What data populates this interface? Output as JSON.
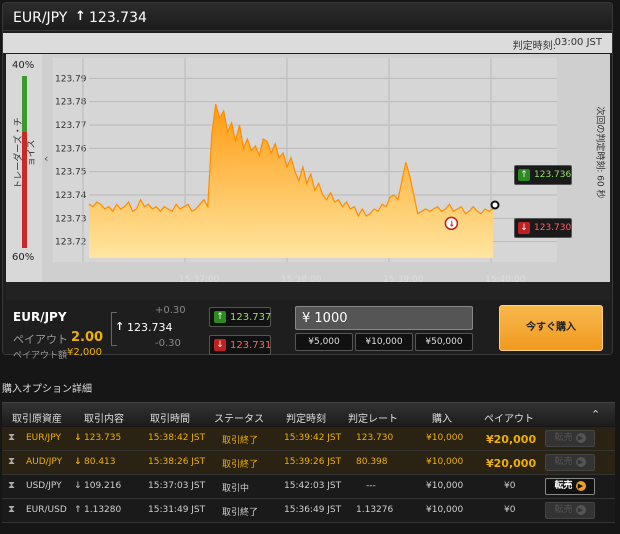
{
  "header": {
    "pair": "EUR/JPY",
    "arrow": "↑",
    "price": "123.734"
  },
  "judge": {
    "label": "判定時刻:",
    "time": "03:00 JST"
  },
  "trader_choice": {
    "top_pct": "40%",
    "bottom_pct": "60%",
    "label": "トレーダーズ・チョイス",
    "collapse": "‹"
  },
  "next_judge": {
    "label": "次回の判定時刻: 60 秒"
  },
  "chart_data": {
    "type": "area",
    "x_ticks": [
      "15:37:00",
      "15:38:00",
      "15:39:00",
      "15:40:00"
    ],
    "y_ticks": [
      "123.79",
      "123.78",
      "123.77",
      "123.76",
      "123.75",
      "123.74",
      "123.73",
      "123.72"
    ],
    "ylim": [
      123.713,
      123.797
    ],
    "x": [
      0,
      2,
      4,
      6,
      8,
      10,
      12,
      14,
      16,
      18,
      20,
      22,
      24,
      26,
      28,
      30,
      32,
      34,
      36,
      38,
      40,
      42,
      44,
      46,
      48,
      50,
      52,
      54,
      56,
      58,
      60,
      62,
      64,
      66,
      68,
      70,
      72,
      74,
      76,
      78,
      80,
      82,
      84,
      86,
      88,
      90,
      92,
      94,
      96,
      98,
      100,
      102,
      104,
      106,
      108,
      110,
      112,
      114,
      116,
      118,
      120,
      122,
      124,
      126,
      128,
      130,
      132,
      134,
      136,
      138,
      140,
      142,
      144,
      146,
      148,
      150,
      152,
      154,
      156,
      158,
      160,
      162,
      164,
      166,
      168,
      170,
      172,
      174,
      176,
      178,
      180,
      182,
      184,
      186,
      188,
      190,
      192,
      194,
      196,
      198,
      200,
      202,
      204
    ],
    "values": [
      123.736,
      123.735,
      123.737,
      123.736,
      123.734,
      123.735,
      123.733,
      123.736,
      123.734,
      123.735,
      123.737,
      123.733,
      123.734,
      123.738,
      123.735,
      123.736,
      123.734,
      123.735,
      123.733,
      123.735,
      123.734,
      123.733,
      123.736,
      123.734,
      123.735,
      123.736,
      123.733,
      123.734,
      123.736,
      123.738,
      123.735,
      123.766,
      123.779,
      123.773,
      123.776,
      123.767,
      123.771,
      123.763,
      123.77,
      123.76,
      123.764,
      123.759,
      123.761,
      123.757,
      123.764,
      123.763,
      123.758,
      123.762,
      123.756,
      123.758,
      123.752,
      123.756,
      123.75,
      123.746,
      123.752,
      123.745,
      123.749,
      123.742,
      123.745,
      123.74,
      123.738,
      123.741,
      123.737,
      123.738,
      123.735,
      123.737,
      123.734,
      123.735,
      123.731,
      123.734,
      123.731,
      123.732,
      123.734,
      123.733,
      123.736,
      123.735,
      123.739,
      123.74,
      123.738,
      123.746,
      123.754,
      123.748,
      123.74,
      123.732,
      123.733,
      123.734,
      123.733,
      123.734,
      123.735,
      123.733,
      123.734,
      123.736,
      123.733,
      123.734,
      123.735,
      123.732,
      123.733,
      123.735,
      123.733,
      123.732,
      123.734,
      123.733,
      123.734
    ],
    "upper_tag": "123.736",
    "lower_tag": "123.730",
    "grid": true,
    "colors": {
      "fill_top": "#ff9a10",
      "fill_bottom": "#ffe6a0",
      "line": "#ff8c00",
      "bg": "#d6d6d6"
    }
  },
  "order": {
    "pair": "EUR/JPY",
    "payout_label": "ペイアウト",
    "payout": "2.00",
    "amount_label": "ペイアウト額",
    "amount": "¥2,000",
    "arrow": "↑",
    "price": "123.734",
    "plus": "+0.30",
    "minus": "-0.30",
    "high_price": "123.737",
    "low_price": "123.731",
    "input_value": "¥ 1000",
    "quick_amounts": [
      "¥5,000",
      "¥10,000",
      "¥50,000"
    ],
    "buy_label": "今すぐ購入"
  },
  "details": {
    "title": "購入オプション詳細",
    "headers": [
      "取引原資産",
      "取引内容",
      "取引時間",
      "ステータス",
      "判定時刻",
      "判定レート",
      "購入",
      "ペイアウト"
    ],
    "collapse_icon": "⌃",
    "rows": [
      {
        "asset": "EUR/JPY",
        "dir": "↓",
        "content": "123.735",
        "time": "15:38:42 JST",
        "status": "取引終了",
        "judge": "15:39:42 JST",
        "rate": "123.730",
        "buy": "¥10,000",
        "payout": "¥20,000",
        "resale": "転売",
        "highlight": true,
        "resale_active": false
      },
      {
        "asset": "AUD/JPY",
        "dir": "↓",
        "content": "80.413",
        "time": "15:38:26 JST",
        "status": "取引終了",
        "judge": "15:39:26 JST",
        "rate": "80.398",
        "buy": "¥10,000",
        "payout": "¥20,000",
        "resale": "転売",
        "highlight": true,
        "resale_active": false
      },
      {
        "asset": "USD/JPY",
        "dir": "↓",
        "content": "109.216",
        "time": "15:37:03 JST",
        "status": "取引中",
        "judge": "15:42:03 JST",
        "rate": "---",
        "buy": "¥10,000",
        "payout": "¥0",
        "resale": "転売",
        "highlight": false,
        "resale_active": true
      },
      {
        "asset": "EUR/USD",
        "dir": "↑",
        "content": "1.13280",
        "time": "15:31:49 JST",
        "status": "取引終了",
        "judge": "15:36:49 JST",
        "rate": "1.13276",
        "buy": "¥10,000",
        "payout": "¥0",
        "resale": "転売",
        "highlight": false,
        "resale_active": false
      }
    ]
  }
}
